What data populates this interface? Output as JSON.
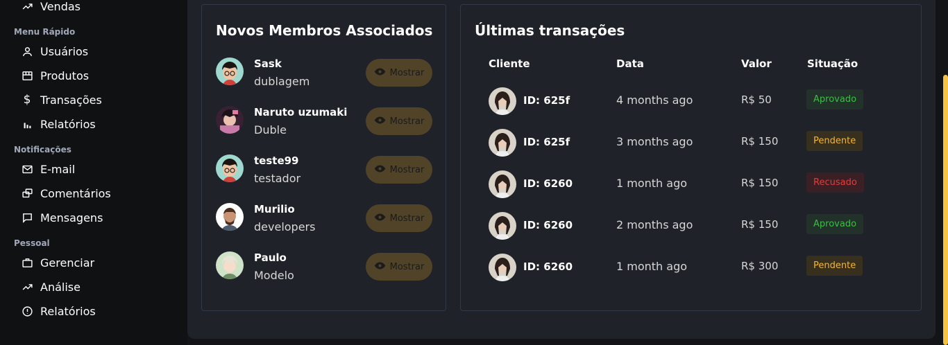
{
  "sidebar": {
    "top_item": {
      "label": "Vendas",
      "icon": "trending-up-icon"
    },
    "sections": [
      {
        "heading": "Menu Rápido",
        "items": [
          {
            "label": "Usuários",
            "icon": "user-icon"
          },
          {
            "label": "Produtos",
            "icon": "storefront-icon"
          },
          {
            "label": "Transações",
            "icon": "dollar-icon"
          },
          {
            "label": "Relatórios",
            "icon": "bar-chart-icon"
          }
        ]
      },
      {
        "heading": "Notificações",
        "items": [
          {
            "label": "E-mail",
            "icon": "mail-icon"
          },
          {
            "label": "Comentários",
            "icon": "comments-icon"
          },
          {
            "label": "Mensagens",
            "icon": "message-icon"
          }
        ]
      },
      {
        "heading": "Pessoal",
        "items": [
          {
            "label": "Gerenciar",
            "icon": "briefcase-icon"
          },
          {
            "label": "Análise",
            "icon": "trending-up-icon"
          },
          {
            "label": "Relatórios",
            "icon": "alert-circle-icon"
          }
        ]
      }
    ]
  },
  "members": {
    "title": "Novos Membros Associados",
    "button_label": "Mostrar",
    "items": [
      {
        "name": "Sask",
        "role": "dublagem"
      },
      {
        "name": "Naruto uzumaki",
        "role": "Duble"
      },
      {
        "name": "teste99",
        "role": "testador"
      },
      {
        "name": "Murilio",
        "role": "developers"
      },
      {
        "name": "Paulo",
        "role": "Modelo"
      }
    ]
  },
  "transactions": {
    "title": "Últimas transações",
    "columns": [
      "Cliente",
      "Data",
      "Valor",
      "Situação"
    ],
    "rows": [
      {
        "id": "ID: 625f",
        "date": "4 months ago",
        "value": "R$ 50",
        "status": "Aprovado"
      },
      {
        "id": "ID: 625f",
        "date": "3 months ago",
        "value": "R$ 150",
        "status": "Pendente"
      },
      {
        "id": "ID: 6260",
        "date": "1 month ago",
        "value": "R$ 150",
        "status": "Recusado"
      },
      {
        "id": "ID: 6260",
        "date": "2 months ago",
        "value": "R$ 150",
        "status": "Aprovado"
      },
      {
        "id": "ID: 6260",
        "date": "1 month ago",
        "value": "R$ 300",
        "status": "Pendente"
      }
    ]
  },
  "colors": {
    "accent": "#f6c244",
    "approved_text": "#3cbd46",
    "approved_bg": "#22322a",
    "pending_text": "#f5b533",
    "pending_bg": "#37301f",
    "refused_text": "#e23d3d",
    "refused_bg": "#3a2025"
  }
}
